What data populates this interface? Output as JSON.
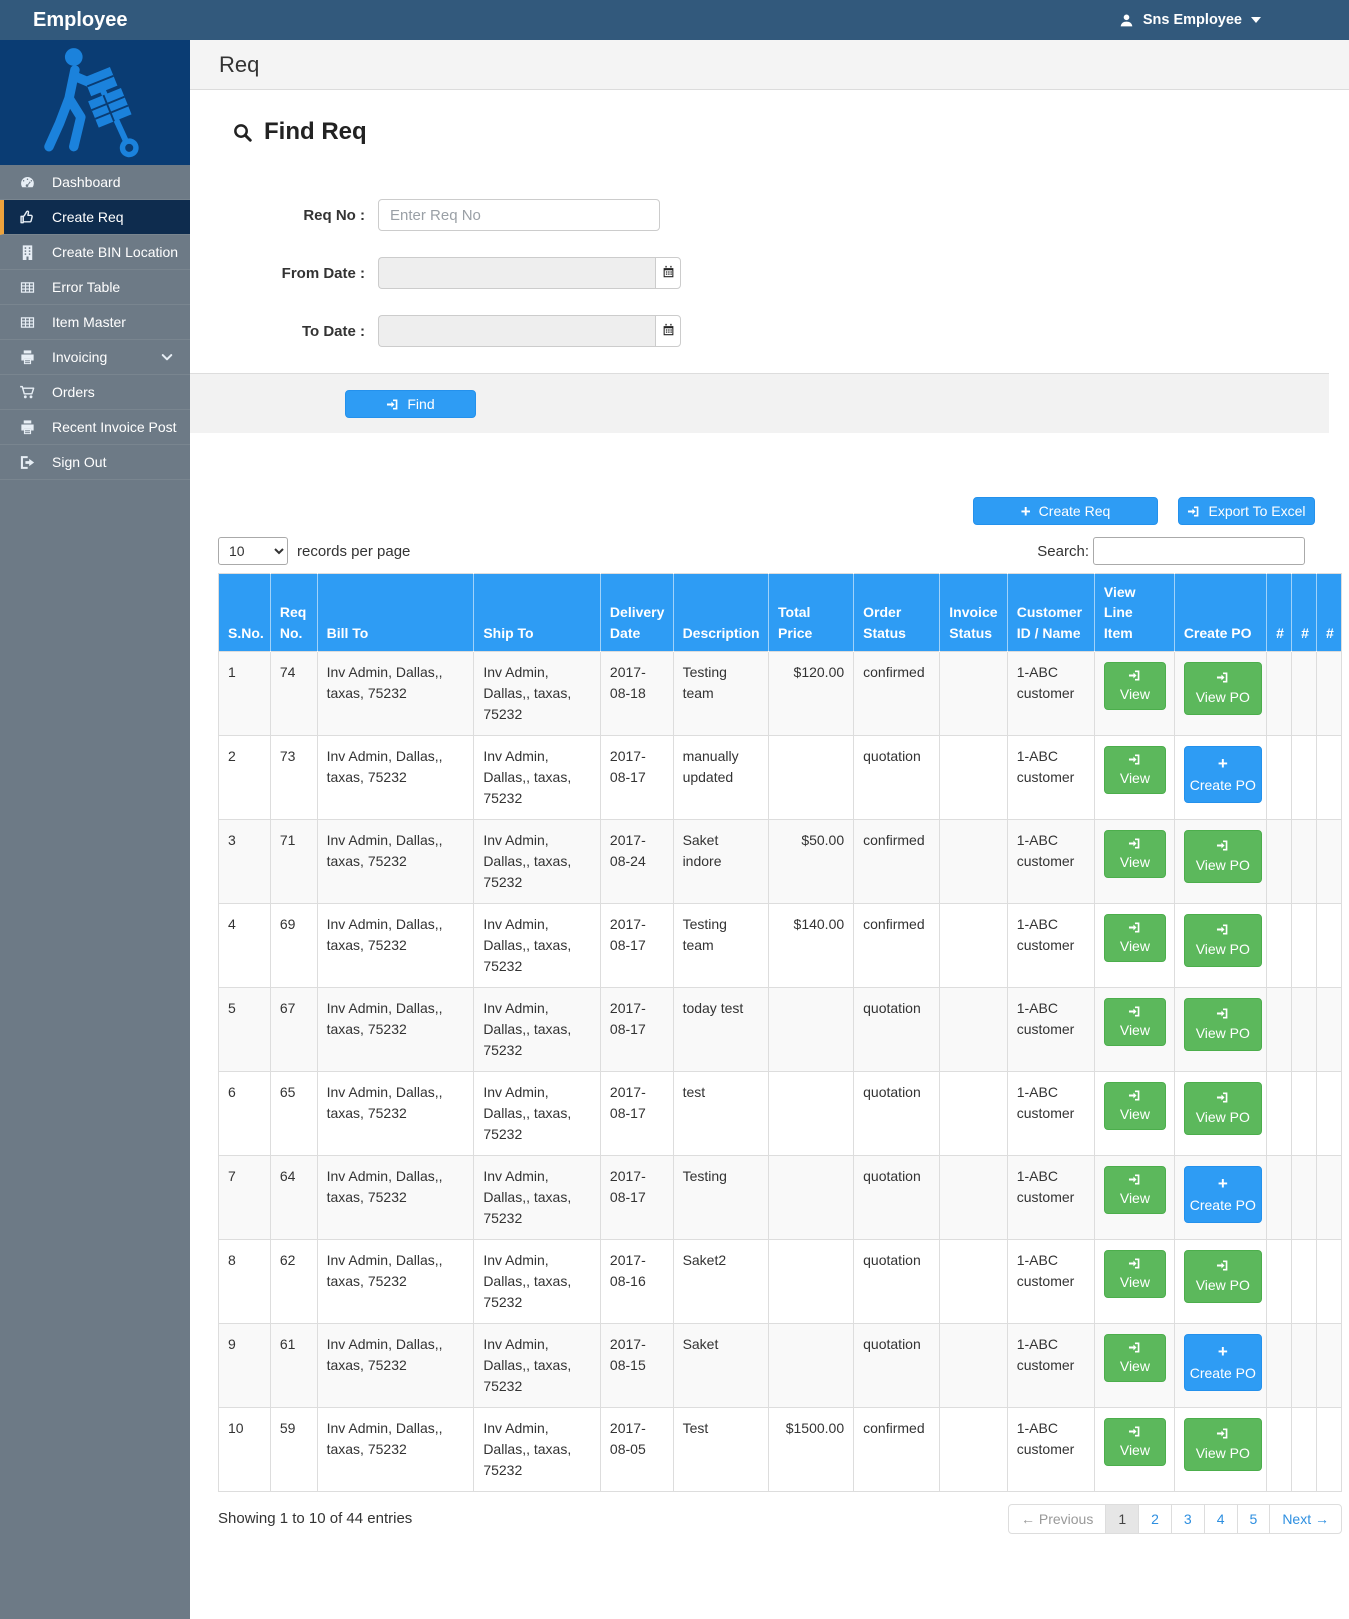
{
  "topbar": {
    "brand": "Employee",
    "user_name": "Sns Employee"
  },
  "sidebar": {
    "items": [
      {
        "label": "Dashboard",
        "icon": "gauge-icon"
      },
      {
        "label": "Create Req",
        "icon": "thumbs-up-icon",
        "active": true
      },
      {
        "label": "Create BIN Location",
        "icon": "building-icon"
      },
      {
        "label": "Error Table",
        "icon": "table-icon"
      },
      {
        "label": "Item Master",
        "icon": "table-icon"
      },
      {
        "label": "Invoicing",
        "icon": "printer-icon",
        "chevron": "chevron-down-icon"
      },
      {
        "label": "Orders",
        "icon": "cart-icon"
      },
      {
        "label": "Recent Invoice Post",
        "icon": "printer-icon"
      },
      {
        "label": "Sign Out",
        "icon": "sign-out-icon"
      }
    ]
  },
  "page": {
    "header": "Req",
    "title": "Find Req"
  },
  "form": {
    "req_no": {
      "label": "Req No :",
      "placeholder": "Enter Req No",
      "value": ""
    },
    "from_date": {
      "label": "From Date :",
      "value": ""
    },
    "to_date": {
      "label": "To Date :",
      "value": ""
    },
    "find_button": "Find"
  },
  "actions": {
    "create_req_button": "Create Req",
    "export_button": "Export To Excel"
  },
  "list_controls": {
    "page_size": "10",
    "page_size_options": [
      "10"
    ],
    "records_label": "records per page",
    "search_label": "Search:",
    "search_value": ""
  },
  "table": {
    "headers": [
      "S.No.",
      "Req No.",
      "Bill To",
      "Ship To",
      "Delivery Date",
      "Description",
      "Total Price",
      "Order Status",
      "Invoice Status",
      "Customer ID / Name",
      "View Line Item",
      "Create PO",
      "#",
      "#",
      "#"
    ],
    "view_button_label": "View",
    "rows": [
      {
        "sno": "1",
        "req_no": "74",
        "bill_to": "Inv Admin, Dallas,, taxas, 75232",
        "ship_to": "Inv Admin, Dallas,, taxas, 75232",
        "delivery_date": "2017-08-18",
        "description": "Testing team",
        "total_price": "$120.00",
        "order_status": "confirmed",
        "invoice_status": "",
        "customer": "1-ABC customer",
        "po_action": "View PO",
        "po_type": "view"
      },
      {
        "sno": "2",
        "req_no": "73",
        "bill_to": "Inv Admin, Dallas,, taxas, 75232",
        "ship_to": "Inv Admin, Dallas,, taxas, 75232",
        "delivery_date": "2017-08-17",
        "description": "manually updated",
        "total_price": "",
        "order_status": "quotation",
        "invoice_status": "",
        "customer": "1-ABC customer",
        "po_action": "Create PO",
        "po_type": "create"
      },
      {
        "sno": "3",
        "req_no": "71",
        "bill_to": "Inv Admin, Dallas,, taxas, 75232",
        "ship_to": "Inv Admin, Dallas,, taxas, 75232",
        "delivery_date": "2017-08-24",
        "description": "Saket indore",
        "total_price": "$50.00",
        "order_status": "confirmed",
        "invoice_status": "",
        "customer": "1-ABC customer",
        "po_action": "View PO",
        "po_type": "view"
      },
      {
        "sno": "4",
        "req_no": "69",
        "bill_to": "Inv Admin, Dallas,, taxas, 75232",
        "ship_to": "Inv Admin, Dallas,, taxas, 75232",
        "delivery_date": "2017-08-17",
        "description": "Testing team",
        "total_price": "$140.00",
        "order_status": "confirmed",
        "invoice_status": "",
        "customer": "1-ABC customer",
        "po_action": "View PO",
        "po_type": "view"
      },
      {
        "sno": "5",
        "req_no": "67",
        "bill_to": "Inv Admin, Dallas,, taxas, 75232",
        "ship_to": "Inv Admin, Dallas,, taxas, 75232",
        "delivery_date": "2017-08-17",
        "description": "today test",
        "total_price": "",
        "order_status": "quotation",
        "invoice_status": "",
        "customer": "1-ABC customer",
        "po_action": "View PO",
        "po_type": "view"
      },
      {
        "sno": "6",
        "req_no": "65",
        "bill_to": "Inv Admin, Dallas,, taxas, 75232",
        "ship_to": "Inv Admin, Dallas,, taxas, 75232",
        "delivery_date": "2017-08-17",
        "description": "test",
        "total_price": "",
        "order_status": "quotation",
        "invoice_status": "",
        "customer": "1-ABC customer",
        "po_action": "View PO",
        "po_type": "view"
      },
      {
        "sno": "7",
        "req_no": "64",
        "bill_to": "Inv Admin, Dallas,, taxas, 75232",
        "ship_to": "Inv Admin, Dallas,, taxas, 75232",
        "delivery_date": "2017-08-17",
        "description": "Testing",
        "total_price": "",
        "order_status": "quotation",
        "invoice_status": "",
        "customer": "1-ABC customer",
        "po_action": "Create PO",
        "po_type": "create"
      },
      {
        "sno": "8",
        "req_no": "62",
        "bill_to": "Inv Admin, Dallas,, taxas, 75232",
        "ship_to": "Inv Admin, Dallas,, taxas, 75232",
        "delivery_date": "2017-08-16",
        "description": "Saket2",
        "total_price": "",
        "order_status": "quotation",
        "invoice_status": "",
        "customer": "1-ABC customer",
        "po_action": "View PO",
        "po_type": "view"
      },
      {
        "sno": "9",
        "req_no": "61",
        "bill_to": "Inv Admin, Dallas,, taxas, 75232",
        "ship_to": "Inv Admin, Dallas,, taxas, 75232",
        "delivery_date": "2017-08-15",
        "description": "Saket",
        "total_price": "",
        "order_status": "quotation",
        "invoice_status": "",
        "customer": "1-ABC customer",
        "po_action": "Create PO",
        "po_type": "create"
      },
      {
        "sno": "10",
        "req_no": "59",
        "bill_to": "Inv Admin, Dallas,, taxas, 75232",
        "ship_to": "Inv Admin, Dallas,, taxas, 75232",
        "delivery_date": "2017-08-05",
        "description": "Test",
        "total_price": "$1500.00",
        "order_status": "confirmed",
        "invoice_status": "",
        "customer": "1-ABC customer",
        "po_action": "View PO",
        "po_type": "view"
      }
    ]
  },
  "footer": {
    "showing_text": "Showing 1 to 10 of 44 entries",
    "pagination": {
      "previous": "← Previous",
      "pages": [
        "1",
        "2",
        "3",
        "4",
        "5"
      ],
      "active_page": "1",
      "next": "Next →"
    }
  },
  "colors": {
    "navbar": "#32597c",
    "sidebar": "#6d7a86",
    "logo_bg": "#0a3c73",
    "active_item_bg": "#0e2c4e",
    "active_item_accent": "#eda33d",
    "accent_blue": "#2e9cf4",
    "success_green": "#5cb85c",
    "table_header": "#2e9cf4"
  }
}
